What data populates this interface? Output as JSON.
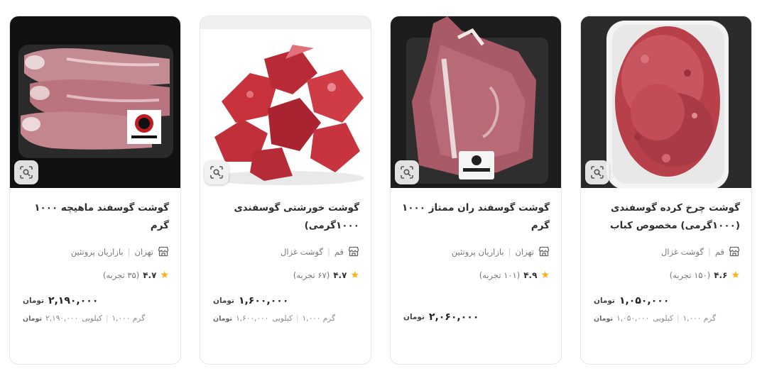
{
  "currency_label": "تومان",
  "products": [
    {
      "title": "گوشت چرخ کرده گوسفندی (۱۰۰۰گرمی) مخصوص کباب",
      "city": "قم",
      "vendor": "گوشت غزال",
      "rating": "۴.۶",
      "reviews": "(۱۵۰ تجربه)",
      "price": "۱,۰۵۰,۰۰۰",
      "unit_price": "۱,۰۵۰,۰۰۰",
      "unit_label": "کیلویی",
      "weight": "۱,۰۰۰ گرم"
    },
    {
      "title": "گوشت گوسفند ران ممتاز ۱۰۰۰ گرم",
      "city": "تهران",
      "vendor": "بازاریان پروتئین",
      "rating": "۴.۹",
      "reviews": "(۱۰۱ تجربه)",
      "price": "۲,۰۶۰,۰۰۰"
    },
    {
      "title": "گوشت خورشتی گوسفندی ۱۰۰۰گرمی)",
      "city": "قم",
      "vendor": "گوشت غزال",
      "rating": "۴.۷",
      "reviews": "(۶۷ تجربه)",
      "price": "۱,۶۰۰,۰۰۰",
      "unit_price": "۱,۶۰۰,۰۰۰",
      "unit_label": "کیلویی",
      "weight": "۱,۰۰۰ گرم"
    },
    {
      "title": "گوشت گوسفند ماهیچه ۱۰۰۰ گرم",
      "city": "تهران",
      "vendor": "بازاریان پروتئین",
      "rating": "۴.۷",
      "reviews": "(۳۵ تجربه)",
      "price": "۲,۱۹۰,۰۰۰",
      "unit_price": "۲,۱۹۰,۰۰۰",
      "unit_label": "کیلویی",
      "weight": "۱,۰۰۰ گرم"
    }
  ],
  "colors": {
    "star": "#f9b21b",
    "border": "#e6e6e6",
    "title": "#2e2e2e"
  }
}
